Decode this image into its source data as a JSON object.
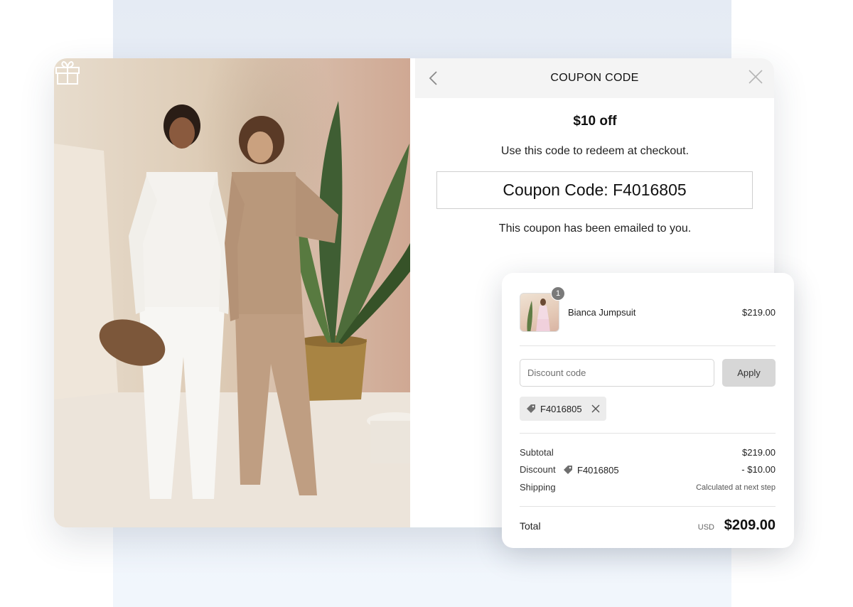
{
  "popup": {
    "title": "COUPON CODE",
    "offer": "$10 off",
    "instructions": "Use this code to redeem at checkout.",
    "coupon_code_text": "Coupon Code: F4016805",
    "emailed_note": "This coupon has been emailed to you."
  },
  "summary": {
    "item": {
      "name": "Bianca Jumpsuit",
      "price": "$219.00",
      "quantity": "1"
    },
    "discount_input": {
      "placeholder": "Discount code",
      "value": ""
    },
    "apply_label": "Apply",
    "applied_code": "F4016805",
    "subtotal_label": "Subtotal",
    "subtotal_value": "$219.00",
    "discount_label": "Discount",
    "discount_code": "F4016805",
    "discount_value": "- $10.00",
    "shipping_label": "Shipping",
    "shipping_value": "Calculated at next step",
    "total_label": "Total",
    "total_currency": "USD",
    "total_value": "$209.00"
  },
  "icons": {
    "gift": "gift-icon",
    "back": "chevron-left-icon",
    "close": "close-icon",
    "tag": "tag-icon",
    "remove": "remove-icon"
  },
  "colors": {
    "backdrop": "#eaf0f8",
    "header_bg": "#f4f4f4",
    "apply_bg": "#d7d7d7",
    "chip_bg": "#ececec"
  }
}
